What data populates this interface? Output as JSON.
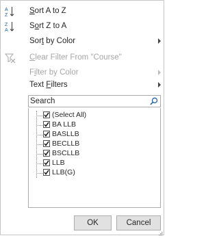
{
  "menu": {
    "sort_az": {
      "prefix": "",
      "key": "S",
      "rest": "ort A to Z",
      "icon": "sort-ascending-icon"
    },
    "sort_za": {
      "prefix": "S",
      "key": "o",
      "rest": "rt Z to A",
      "icon": "sort-descending-icon"
    },
    "sort_color": {
      "prefix": "Sor",
      "key": "t",
      "rest": " by Color"
    },
    "clear_filter": {
      "prefix": "",
      "key": "C",
      "rest": "lear Filter From \"Course\"",
      "icon": "clear-filter-icon"
    },
    "filter_color": {
      "prefix": "F",
      "key": "i",
      "rest": "lter by Color"
    },
    "text_filters": {
      "prefix": "Text ",
      "key": "F",
      "rest": "ilters"
    }
  },
  "search": {
    "placeholder": "Search"
  },
  "filter_list": {
    "items": [
      {
        "label": "(Select All)",
        "checked": true
      },
      {
        "label": "BA LLB",
        "checked": true
      },
      {
        "label": "BASLLB",
        "checked": true
      },
      {
        "label": "BECLLB",
        "checked": true
      },
      {
        "label": "BSCLLB",
        "checked": true
      },
      {
        "label": "LLB",
        "checked": true
      },
      {
        "label": "LLB(G)",
        "checked": true
      }
    ]
  },
  "buttons": {
    "ok": "OK",
    "cancel": "Cancel"
  }
}
